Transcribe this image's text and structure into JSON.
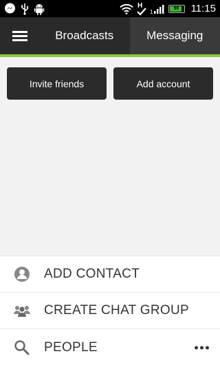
{
  "status_bar": {
    "time": "11:15",
    "battery_level": "90",
    "network_type": "H",
    "icons": [
      "messenger-icon",
      "usb-icon",
      "android-debug-icon",
      "wifi-icon",
      "network-h-icon",
      "signal-icon",
      "battery-icon"
    ]
  },
  "action_bar": {
    "tabs": [
      {
        "label": "Broadcasts"
      },
      {
        "label": "Messaging"
      }
    ],
    "active_tab": "Messaging",
    "accent_color": "#8dc63f"
  },
  "buttons": {
    "invite_label": "Invite friends",
    "add_account_label": "Add account"
  },
  "bottom_menu": {
    "items": [
      {
        "label": "ADD CONTACT",
        "icon": "person-icon"
      },
      {
        "label": "CREATE CHAT GROUP",
        "icon": "group-icon"
      },
      {
        "label": "PEOPLE",
        "icon": "search-icon"
      }
    ],
    "overflow_icon": "overflow-menu-icon"
  }
}
